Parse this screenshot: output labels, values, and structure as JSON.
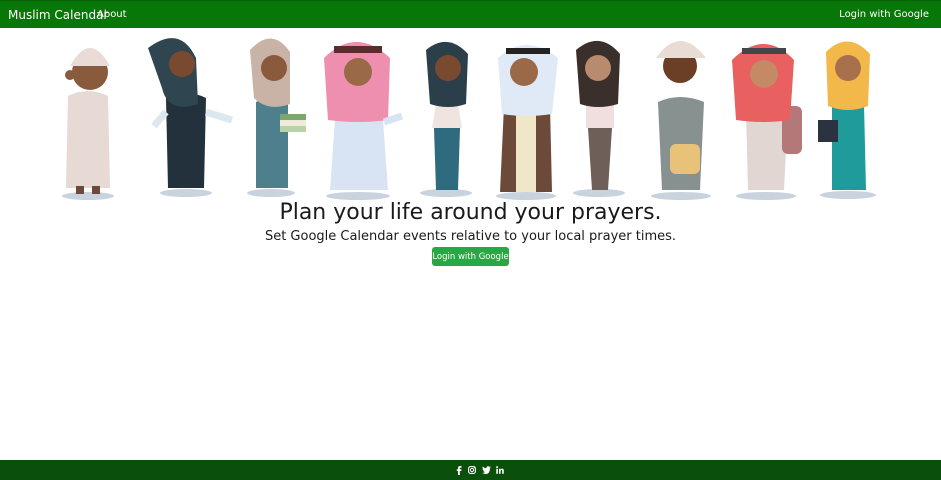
{
  "nav": {
    "brand": "Muslim Calendar",
    "about": "About",
    "login": "Login with Google"
  },
  "hero": {
    "headline": "Plan your life around your prayers.",
    "subheadline": "Set Google Calendar events relative to your local prayer times.",
    "cta": "Login with Google"
  },
  "footer": {
    "social_icons": [
      "facebook-icon",
      "instagram-icon",
      "twitter-icon",
      "linkedin-icon"
    ]
  },
  "colors": {
    "navbar": "#077707",
    "footer": "#0a4f0a",
    "cta": "#28a745"
  }
}
